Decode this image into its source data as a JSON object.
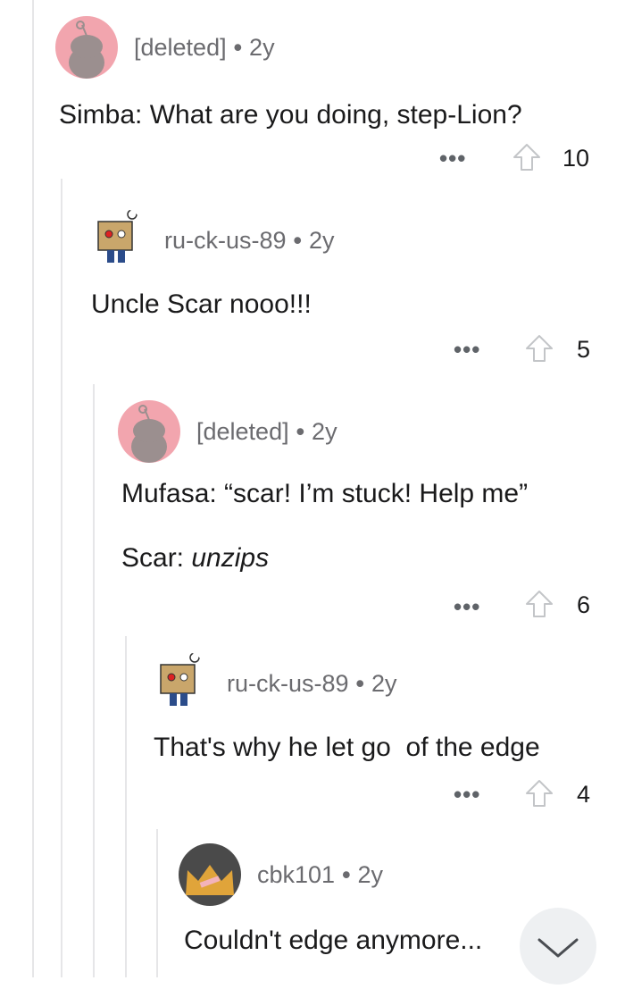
{
  "comments": [
    {
      "username": "[deleted]",
      "age": "2y",
      "lines": [
        "Simba: What are you doing, step-Lion?"
      ],
      "score": "10",
      "avatar": "snoo-deleted-icon"
    },
    {
      "username": "ru-ck-us-89",
      "age": "2y",
      "lines": [
        "Uncle Scar nooo!!!"
      ],
      "score": "5",
      "avatar": "snoo-box-icon"
    },
    {
      "username": "[deleted]",
      "age": "2y",
      "lines": [
        "Mufasa: “scar! I’m stuck! Help me”"
      ],
      "line2_prefix": "Scar: ",
      "line2_italic": "unzips",
      "score": "6",
      "avatar": "snoo-deleted-icon"
    },
    {
      "username": "ru-ck-us-89",
      "age": "2y",
      "lines": [
        "That's why he let go  of the edge"
      ],
      "score": "4",
      "avatar": "snoo-box-icon"
    },
    {
      "username": "cbk101",
      "age": "2y",
      "lines": [
        "Couldn't edge anymore..."
      ],
      "avatar": "crown-avatar-icon"
    }
  ],
  "separator": "•",
  "more_label": "•••",
  "colors": {
    "deleted_avatar_bg": "#f2a5ae",
    "crown": "#e0a43a",
    "upvote": "#878a8c"
  }
}
